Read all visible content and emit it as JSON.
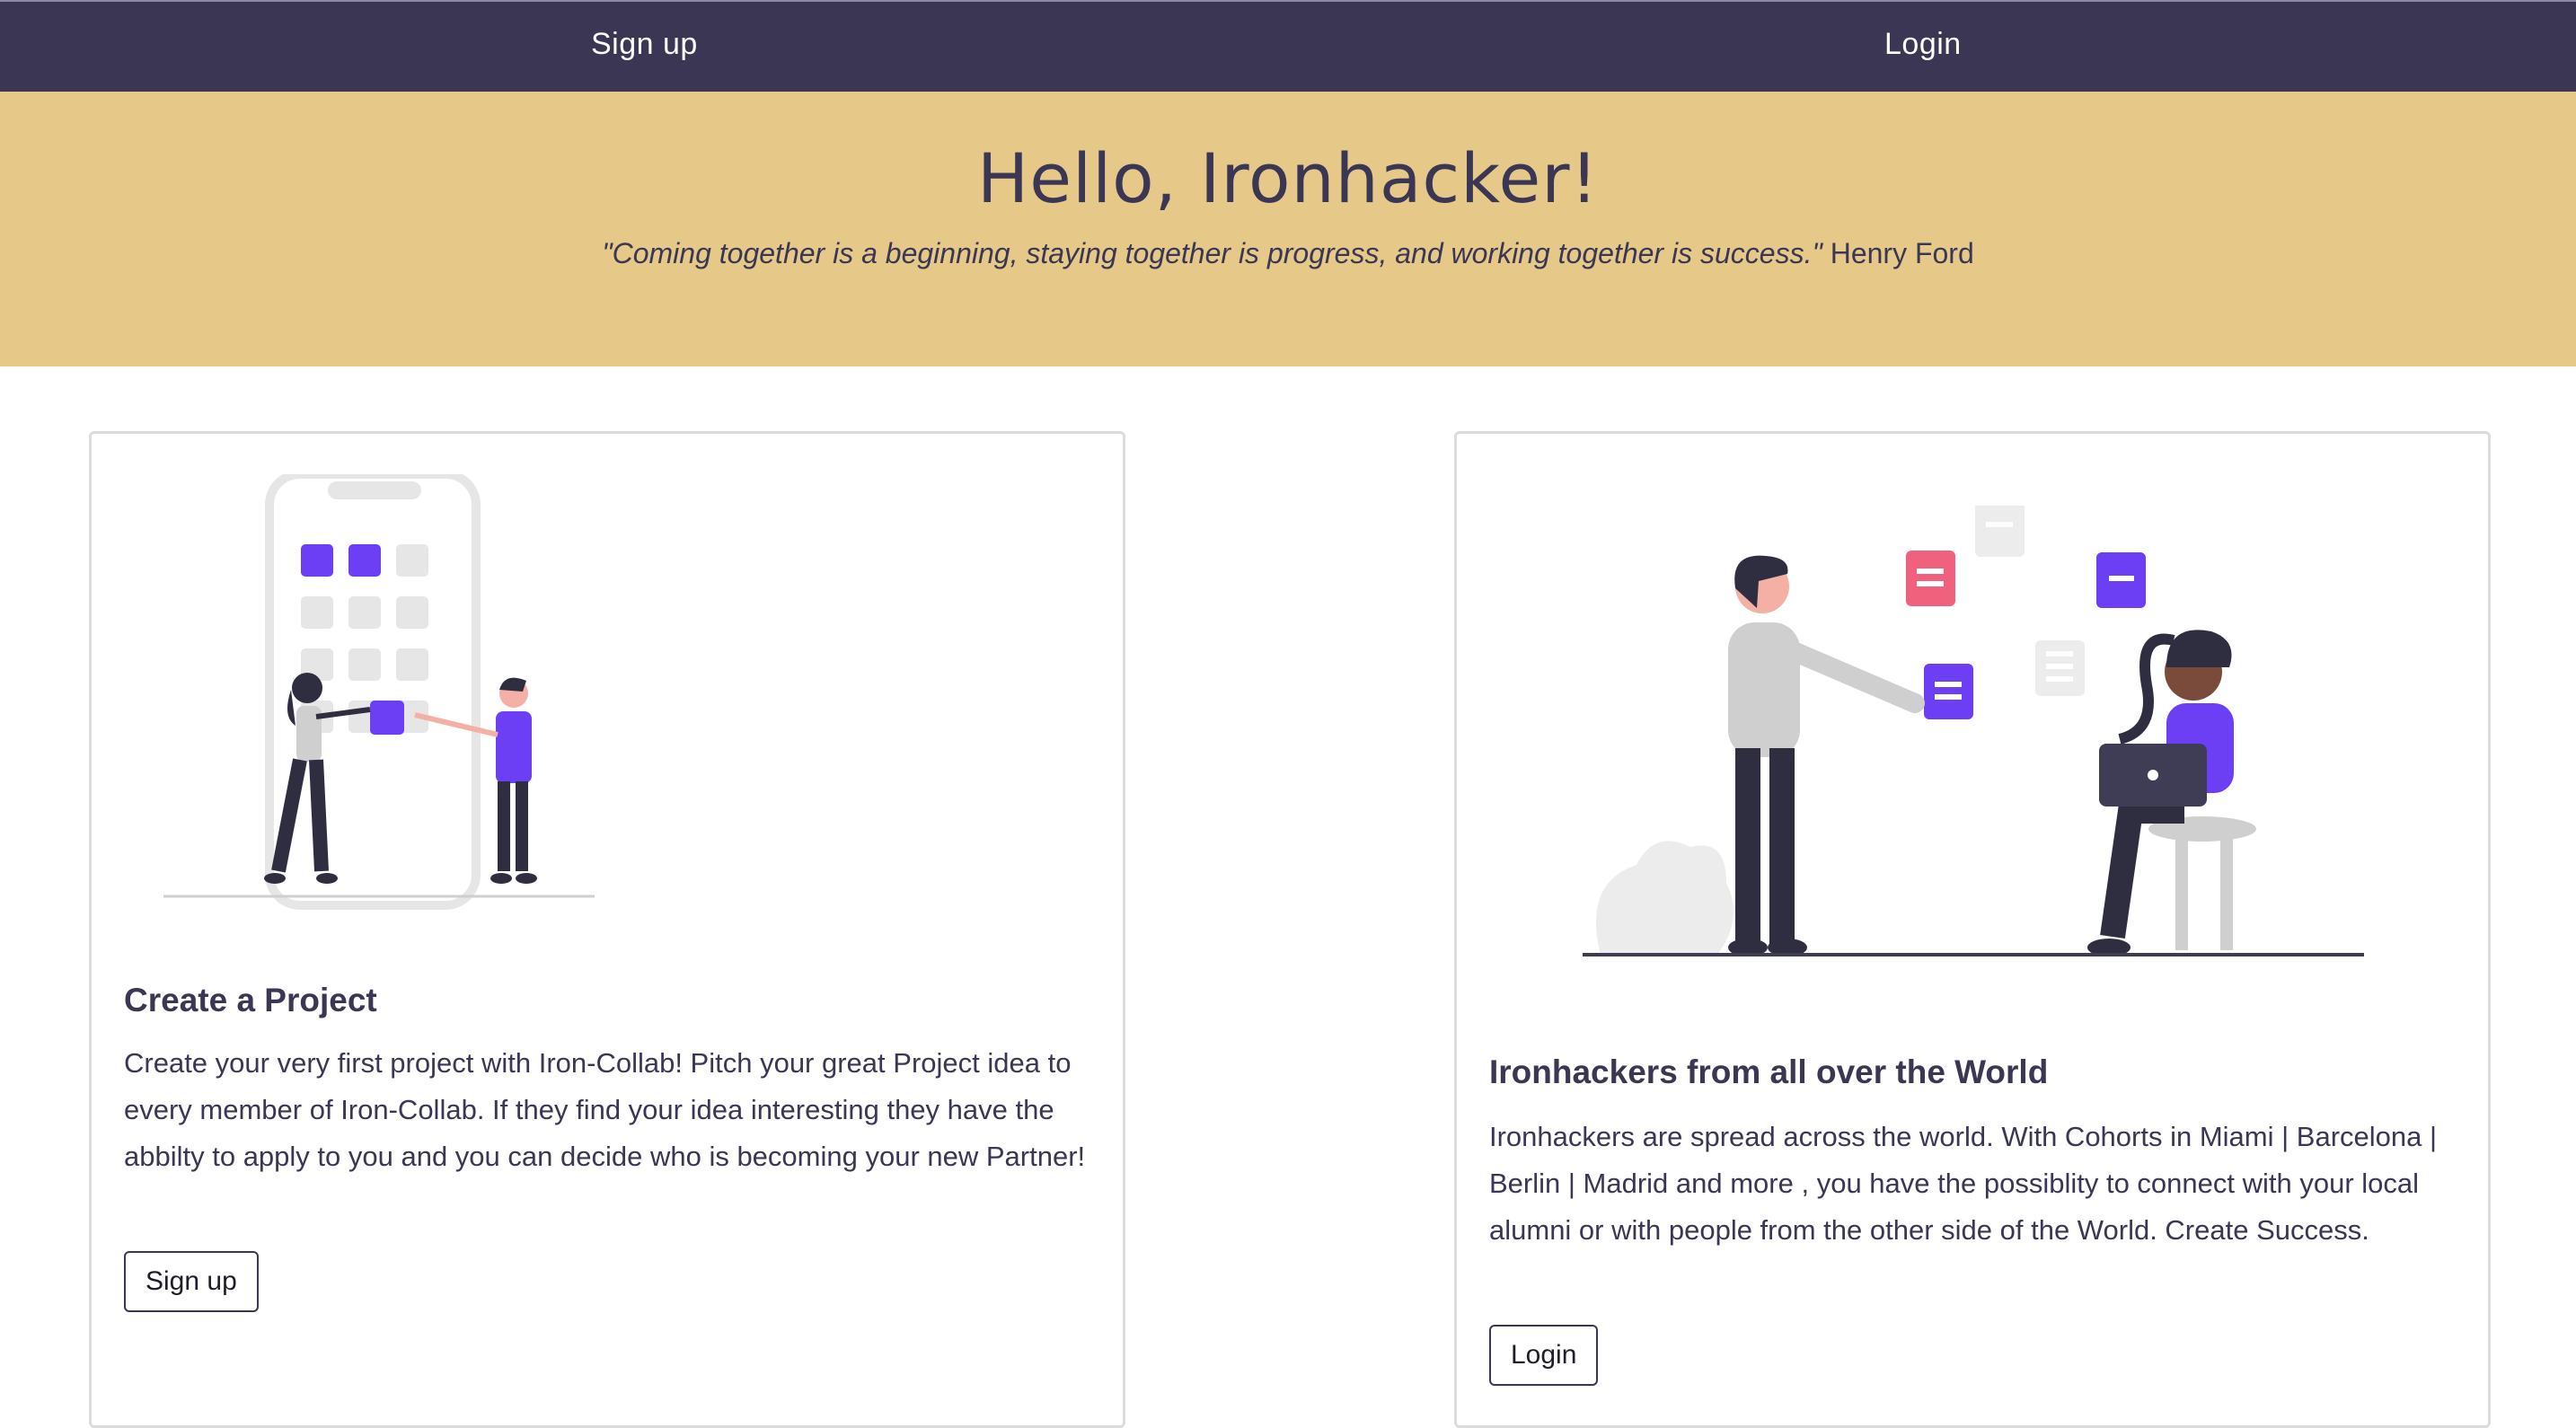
{
  "nav": {
    "signup_label": "Sign up",
    "login_label": "Login"
  },
  "hero": {
    "title": "Hello, Ironhacker!",
    "quote": "\"Coming together is a beginning, staying together is progress, and working together is success.\"",
    "author": "Henry Ford"
  },
  "cards": [
    {
      "title": "Create a Project",
      "text": "Create your very first project with Iron-Collab! Pitch your great Project idea to every member of Iron-Collab. If they find your idea interesting they have the abbilty to apply to you and you can decide who is becoming your new Partner!",
      "button_label": "Sign up",
      "illustration": "people-building-app-illustration"
    },
    {
      "title": "Ironhackers from all over the World",
      "text": "Ironhackers are spread across the world. With Cohorts in Miami | Barcelona | Berlin | Madrid and more , you have the possiblity to connect with your local alumni or with people from the other side of the World. Create Success.",
      "button_label": "Login",
      "illustration": "people-messaging-illustration"
    }
  ],
  "colors": {
    "navbar": "#3a3653",
    "hero": "#e6c988",
    "accent": "#6c3ff5",
    "pink": "#f0617e"
  }
}
